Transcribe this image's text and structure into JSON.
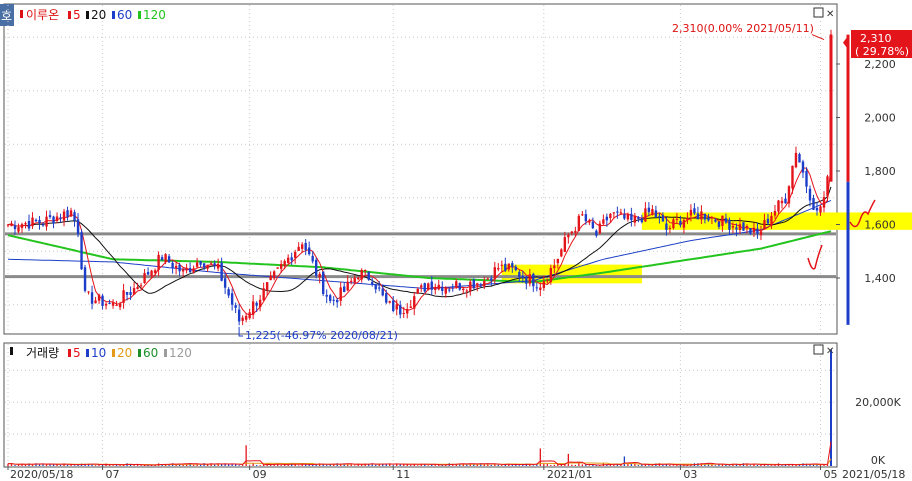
{
  "chart_data": [
    {
      "type": "candlestick",
      "title_tab": "호",
      "legend": {
        "name": "이루온",
        "items": [
          {
            "label": "5",
            "color": "#e4141b"
          },
          {
            "label": "20",
            "color": "#111111"
          },
          {
            "label": "60",
            "color": "#1d3ec8"
          },
          {
            "label": "120",
            "color": "#24c41f"
          }
        ]
      },
      "ylim": [
        1225,
        2310
      ],
      "y_ticks": [
        "2,200",
        "2,000",
        "1,800",
        "1,600",
        "1,400"
      ],
      "y_tick_values": [
        2200,
        2000,
        1800,
        1600,
        1400
      ],
      "x_ticks": [
        "2020/05/18",
        "07",
        "09",
        "11",
        "2021/01",
        "03",
        "05"
      ],
      "x_tick_index": [
        0,
        27,
        69,
        110,
        153,
        192,
        232
      ],
      "last_date": "2021/05/18",
      "n_candles": 236,
      "high_annotation": "2,310(0.00% 2021/05/11)",
      "low_annotation": "1,225(-46.97% 2020/08/21)",
      "last_price_label": "2,310",
      "last_change_label": "( 29.78%)",
      "horizontal_lines": [
        1565,
        1405
      ],
      "key_points": [
        {
          "i": 0,
          "p": 1600
        },
        {
          "i": 10,
          "p": 1610
        },
        {
          "i": 18,
          "p": 1650
        },
        {
          "i": 20,
          "p": 1580
        },
        {
          "i": 22,
          "p": 1330
        },
        {
          "i": 30,
          "p": 1300
        },
        {
          "i": 36,
          "p": 1360
        },
        {
          "i": 44,
          "p": 1480
        },
        {
          "i": 50,
          "p": 1420
        },
        {
          "i": 55,
          "p": 1470
        },
        {
          "i": 60,
          "p": 1430
        },
        {
          "i": 66,
          "p": 1240
        },
        {
          "i": 72,
          "p": 1330
        },
        {
          "i": 78,
          "p": 1440
        },
        {
          "i": 84,
          "p": 1540
        },
        {
          "i": 88,
          "p": 1420
        },
        {
          "i": 92,
          "p": 1310
        },
        {
          "i": 96,
          "p": 1350
        },
        {
          "i": 100,
          "p": 1420
        },
        {
          "i": 104,
          "p": 1400
        },
        {
          "i": 108,
          "p": 1300
        },
        {
          "i": 112,
          "p": 1280
        },
        {
          "i": 116,
          "p": 1330
        },
        {
          "i": 120,
          "p": 1380
        },
        {
          "i": 126,
          "p": 1370
        },
        {
          "i": 132,
          "p": 1380
        },
        {
          "i": 136,
          "p": 1390
        },
        {
          "i": 140,
          "p": 1440
        },
        {
          "i": 144,
          "p": 1430
        },
        {
          "i": 148,
          "p": 1400
        },
        {
          "i": 152,
          "p": 1380
        },
        {
          "i": 156,
          "p": 1450
        },
        {
          "i": 160,
          "p": 1560
        },
        {
          "i": 164,
          "p": 1630
        },
        {
          "i": 168,
          "p": 1560
        },
        {
          "i": 172,
          "p": 1640
        },
        {
          "i": 178,
          "p": 1610
        },
        {
          "i": 184,
          "p": 1650
        },
        {
          "i": 188,
          "p": 1580
        },
        {
          "i": 192,
          "p": 1620
        },
        {
          "i": 198,
          "p": 1640
        },
        {
          "i": 204,
          "p": 1610
        },
        {
          "i": 210,
          "p": 1590
        },
        {
          "i": 214,
          "p": 1560
        },
        {
          "i": 218,
          "p": 1640
        },
        {
          "i": 222,
          "p": 1700
        },
        {
          "i": 225,
          "p": 1880
        },
        {
          "i": 228,
          "p": 1750
        },
        {
          "i": 231,
          "p": 1640
        },
        {
          "i": 233,
          "p": 1700
        },
        {
          "i": 234,
          "p": 1760
        },
        {
          "i": 235,
          "p": 2290
        }
      ],
      "ma_120_points": [
        {
          "i": 0,
          "p": 1560
        },
        {
          "i": 30,
          "p": 1470
        },
        {
          "i": 60,
          "p": 1460
        },
        {
          "i": 90,
          "p": 1440
        },
        {
          "i": 120,
          "p": 1400
        },
        {
          "i": 150,
          "p": 1385
        },
        {
          "i": 170,
          "p": 1420
        },
        {
          "i": 195,
          "p": 1470
        },
        {
          "i": 215,
          "p": 1510
        },
        {
          "i": 235,
          "p": 1575
        }
      ],
      "ma_60_points": [
        {
          "i": 0,
          "p": 1470
        },
        {
          "i": 30,
          "p": 1460
        },
        {
          "i": 60,
          "p": 1420
        },
        {
          "i": 90,
          "p": 1390
        },
        {
          "i": 120,
          "p": 1360
        },
        {
          "i": 150,
          "p": 1390
        },
        {
          "i": 170,
          "p": 1470
        },
        {
          "i": 195,
          "p": 1540
        },
        {
          "i": 215,
          "p": 1580
        },
        {
          "i": 235,
          "p": 1690
        }
      ]
    },
    {
      "type": "bar",
      "legend": {
        "name": "거래량",
        "items": [
          {
            "label": "5",
            "color": "#e4141b"
          },
          {
            "label": "10",
            "color": "#1d3ec8"
          },
          {
            "label": "20",
            "color": "#e39a17"
          },
          {
            "label": "60",
            "color": "#1c8f2a"
          },
          {
            "label": "120",
            "color": "#9b9b9b"
          }
        ]
      },
      "ylim": [
        0,
        37000
      ],
      "y_ticks": [
        "20,000K",
        "0K"
      ],
      "y_tick_values": [
        20000,
        0
      ],
      "spike_last": 36500,
      "spike_events": [
        {
          "i": 68,
          "v": 6500
        },
        {
          "i": 152,
          "v": 5500
        },
        {
          "i": 160,
          "v": 3800
        },
        {
          "i": 176,
          "v": 3000
        }
      ]
    }
  ],
  "window": {
    "button_restore": "□",
    "button_close": "✕"
  }
}
